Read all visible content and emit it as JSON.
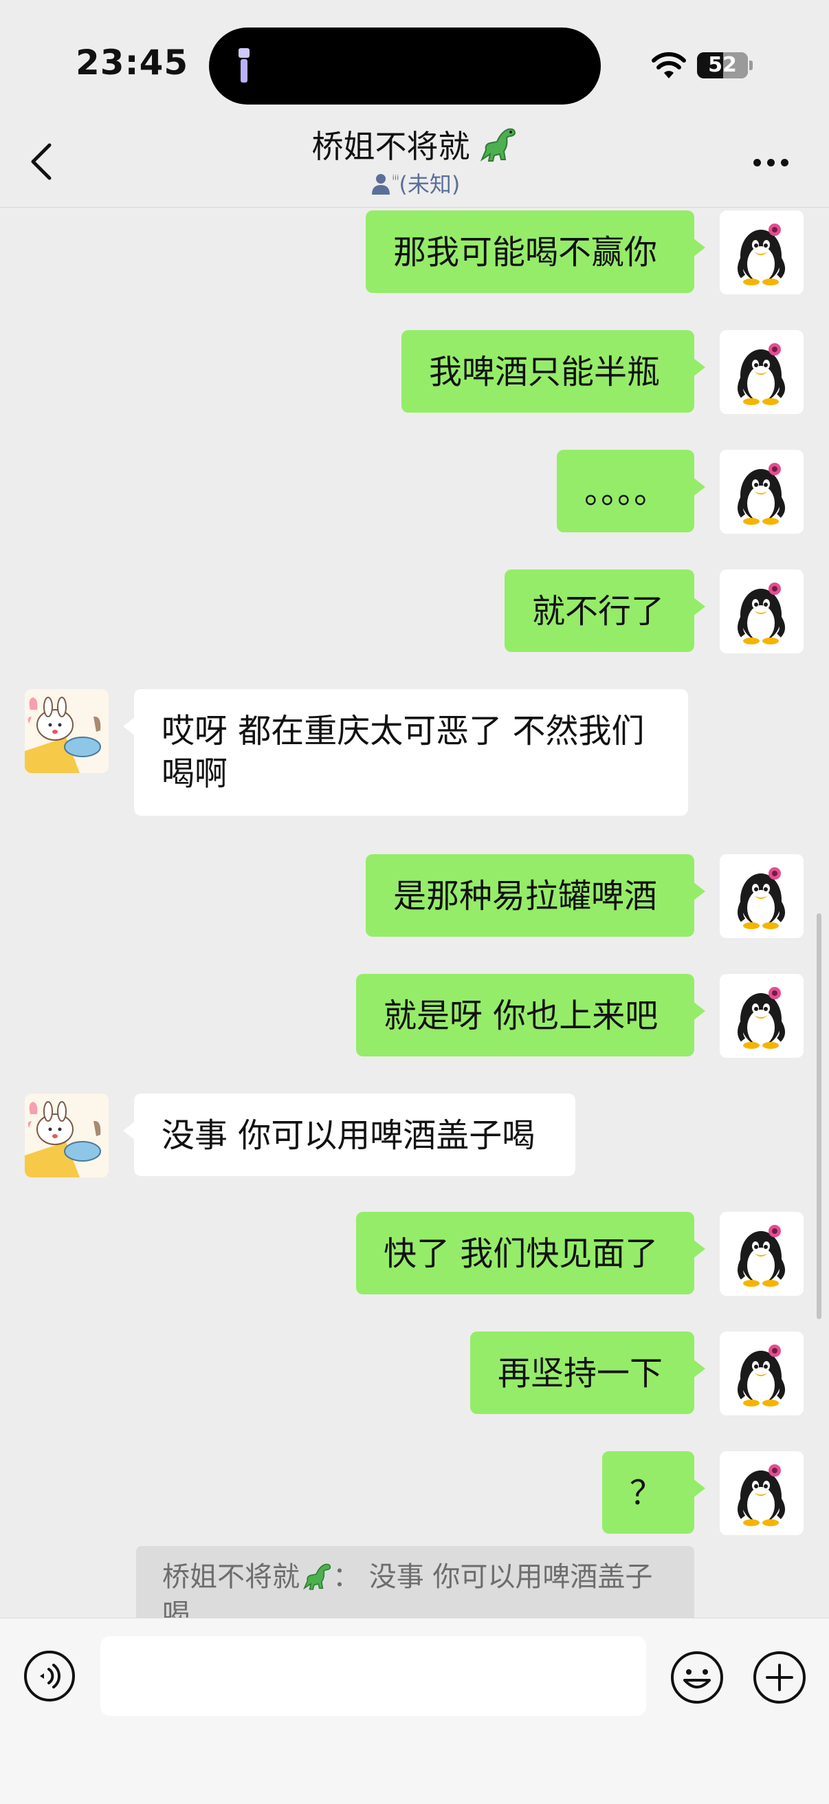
{
  "status_bar": {
    "time": "23:45",
    "battery": "52",
    "battery_level": 0.52
  },
  "header": {
    "title": "桥姐不将就",
    "status_glyph": "ⁱⁱⁱ",
    "status_text": "(未知)"
  },
  "messages": [
    {
      "from": "me",
      "text": "那我可能喝不赢你"
    },
    {
      "from": "me",
      "text": "我啤酒只能半瓶"
    },
    {
      "from": "me",
      "text": "。。。。"
    },
    {
      "from": "me",
      "text": "就不行了"
    },
    {
      "from": "them",
      "text": "哎呀 都在重庆太可恶了 不然我们\n喝啊"
    },
    {
      "from": "me",
      "text": "是那种易拉罐啤酒"
    },
    {
      "from": "me",
      "text": "就是呀 你也上来吧"
    },
    {
      "from": "them",
      "text": "没事 你可以用啤酒盖子喝"
    },
    {
      "from": "me",
      "text": "快了 我们快见面了"
    },
    {
      "from": "me",
      "text": "再坚持一下"
    },
    {
      "from": "me",
      "text": "？"
    }
  ],
  "quote": {
    "name": "桥姐不将就",
    "text": "： 没事 你可以用啤酒盖子喝"
  },
  "icons": {
    "back": "chevron-left-icon",
    "more": "more-dots-icon",
    "voice": "voice-icon",
    "emoji": "emoji-icon",
    "plus": "plus-icon"
  },
  "colors": {
    "my_bubble": "#95ec69",
    "their_bubble": "#ffffff",
    "background": "#ededed"
  }
}
